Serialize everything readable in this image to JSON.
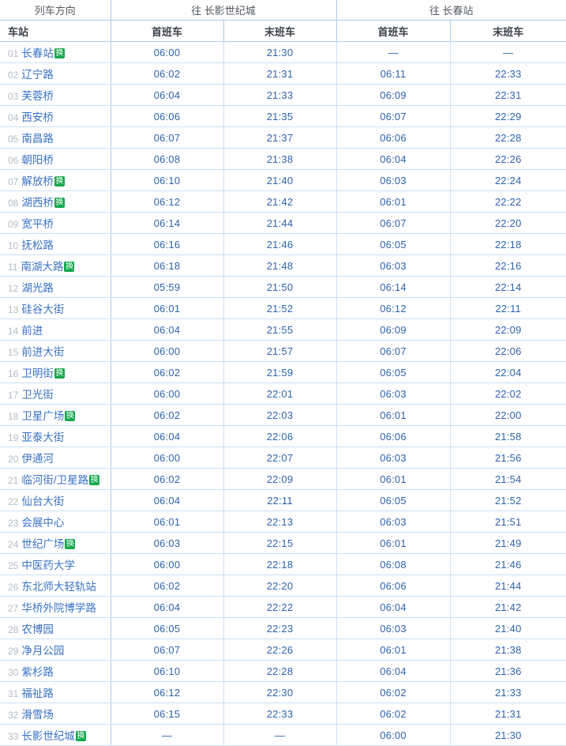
{
  "header": {
    "direction_label": "列车方向",
    "group_1": "往 长影世纪城",
    "group_2": "往 长春站",
    "col_station": "车站",
    "col_first": "首班车",
    "col_last": "末班车"
  },
  "legend": {
    "transfer_badge": "换"
  },
  "colors": {
    "link": "#3a72c4",
    "time": "#2f63ab",
    "number": "#b5bcc4",
    "badge_green": "#12a94b",
    "border_strong": "#a9cdf0",
    "border_light": "#cde0f5"
  },
  "table": {
    "columns": [
      "车站",
      "首班车",
      "末班车",
      "首班车",
      "末班车"
    ],
    "rows": [
      {
        "no": "01",
        "name": "长春站",
        "transfer": true,
        "a_first": "06:00",
        "a_last": "21:30",
        "b_first": "—",
        "b_last": "—"
      },
      {
        "no": "02",
        "name": "辽宁路",
        "transfer": false,
        "a_first": "06:02",
        "a_last": "21:31",
        "b_first": "06:11",
        "b_last": "22:33"
      },
      {
        "no": "03",
        "name": "芙蓉桥",
        "transfer": false,
        "a_first": "06:04",
        "a_last": "21:33",
        "b_first": "06:09",
        "b_last": "22:31"
      },
      {
        "no": "04",
        "name": "西安桥",
        "transfer": false,
        "a_first": "06:06",
        "a_last": "21:35",
        "b_first": "06:07",
        "b_last": "22:29"
      },
      {
        "no": "05",
        "name": "南昌路",
        "transfer": false,
        "a_first": "06:07",
        "a_last": "21:37",
        "b_first": "06:06",
        "b_last": "22:28"
      },
      {
        "no": "06",
        "name": "朝阳桥",
        "transfer": false,
        "a_first": "06:08",
        "a_last": "21:38",
        "b_first": "06:04",
        "b_last": "22:26"
      },
      {
        "no": "07",
        "name": "解放桥",
        "transfer": true,
        "a_first": "06:10",
        "a_last": "21:40",
        "b_first": "06:03",
        "b_last": "22:24"
      },
      {
        "no": "08",
        "name": "湖西桥",
        "transfer": true,
        "a_first": "06:12",
        "a_last": "21:42",
        "b_first": "06:01",
        "b_last": "22:22"
      },
      {
        "no": "09",
        "name": "宽平桥",
        "transfer": false,
        "a_first": "06:14",
        "a_last": "21:44",
        "b_first": "06:07",
        "b_last": "22:20"
      },
      {
        "no": "10",
        "name": "抚松路",
        "transfer": false,
        "a_first": "06:16",
        "a_last": "21:46",
        "b_first": "06:05",
        "b_last": "22:18"
      },
      {
        "no": "11",
        "name": "南湖大路",
        "transfer": true,
        "a_first": "06:18",
        "a_last": "21:48",
        "b_first": "06:03",
        "b_last": "22:16"
      },
      {
        "no": "12",
        "name": "湖光路",
        "transfer": false,
        "a_first": "05:59",
        "a_last": "21:50",
        "b_first": "06:14",
        "b_last": "22:14"
      },
      {
        "no": "13",
        "name": "硅谷大街",
        "transfer": false,
        "a_first": "06:01",
        "a_last": "21:52",
        "b_first": "06:12",
        "b_last": "22:11"
      },
      {
        "no": "14",
        "name": "前进",
        "transfer": false,
        "a_first": "06:04",
        "a_last": "21:55",
        "b_first": "06:09",
        "b_last": "22:09"
      },
      {
        "no": "15",
        "name": "前进大街",
        "transfer": false,
        "a_first": "06:00",
        "a_last": "21:57",
        "b_first": "06:07",
        "b_last": "22:06"
      },
      {
        "no": "16",
        "name": "卫明街",
        "transfer": true,
        "a_first": "06:02",
        "a_last": "21:59",
        "b_first": "06:05",
        "b_last": "22:04"
      },
      {
        "no": "17",
        "name": "卫光街",
        "transfer": false,
        "a_first": "06:00",
        "a_last": "22:01",
        "b_first": "06:03",
        "b_last": "22:02"
      },
      {
        "no": "18",
        "name": "卫星广场",
        "transfer": true,
        "a_first": "06:02",
        "a_last": "22:03",
        "b_first": "06:01",
        "b_last": "22:00"
      },
      {
        "no": "19",
        "name": "亚泰大街",
        "transfer": false,
        "a_first": "06:04",
        "a_last": "22:06",
        "b_first": "06:06",
        "b_last": "21:58"
      },
      {
        "no": "20",
        "name": "伊通河",
        "transfer": false,
        "a_first": "06:00",
        "a_last": "22:07",
        "b_first": "06:03",
        "b_last": "21:56"
      },
      {
        "no": "21",
        "name": "临河街/卫星路",
        "transfer": true,
        "a_first": "06:02",
        "a_last": "22:09",
        "b_first": "06:01",
        "b_last": "21:54"
      },
      {
        "no": "22",
        "name": "仙台大街",
        "transfer": false,
        "a_first": "06:04",
        "a_last": "22:11",
        "b_first": "06:05",
        "b_last": "21:52"
      },
      {
        "no": "23",
        "name": "会展中心",
        "transfer": false,
        "a_first": "06:01",
        "a_last": "22:13",
        "b_first": "06:03",
        "b_last": "21:51"
      },
      {
        "no": "24",
        "name": "世纪广场",
        "transfer": true,
        "a_first": "06:03",
        "a_last": "22:15",
        "b_first": "06:01",
        "b_last": "21:49"
      },
      {
        "no": "25",
        "name": "中医药大学",
        "transfer": false,
        "a_first": "06:00",
        "a_last": "22:18",
        "b_first": "06:08",
        "b_last": "21:46"
      },
      {
        "no": "26",
        "name": "东北师大轻轨站",
        "transfer": false,
        "a_first": "06:02",
        "a_last": "22:20",
        "b_first": "06:06",
        "b_last": "21:44"
      },
      {
        "no": "27",
        "name": "华桥外院博学路",
        "transfer": false,
        "a_first": "06:04",
        "a_last": "22:22",
        "b_first": "06:04",
        "b_last": "21:42"
      },
      {
        "no": "28",
        "name": "农博园",
        "transfer": false,
        "a_first": "06:05",
        "a_last": "22:23",
        "b_first": "06:03",
        "b_last": "21:40"
      },
      {
        "no": "29",
        "name": "净月公园",
        "transfer": false,
        "a_first": "06:07",
        "a_last": "22:26",
        "b_first": "06:01",
        "b_last": "21:38"
      },
      {
        "no": "30",
        "name": "紫杉路",
        "transfer": false,
        "a_first": "06:10",
        "a_last": "22:28",
        "b_first": "06:04",
        "b_last": "21:36"
      },
      {
        "no": "31",
        "name": "福祉路",
        "transfer": false,
        "a_first": "06:12",
        "a_last": "22:30",
        "b_first": "06:02",
        "b_last": "21:33"
      },
      {
        "no": "32",
        "name": "滑雪场",
        "transfer": false,
        "a_first": "06:15",
        "a_last": "22:33",
        "b_first": "06:02",
        "b_last": "21:31"
      },
      {
        "no": "33",
        "name": "长影世纪城",
        "transfer": true,
        "a_first": "—",
        "a_last": "—",
        "b_first": "06:00",
        "b_last": "21:30"
      }
    ]
  }
}
